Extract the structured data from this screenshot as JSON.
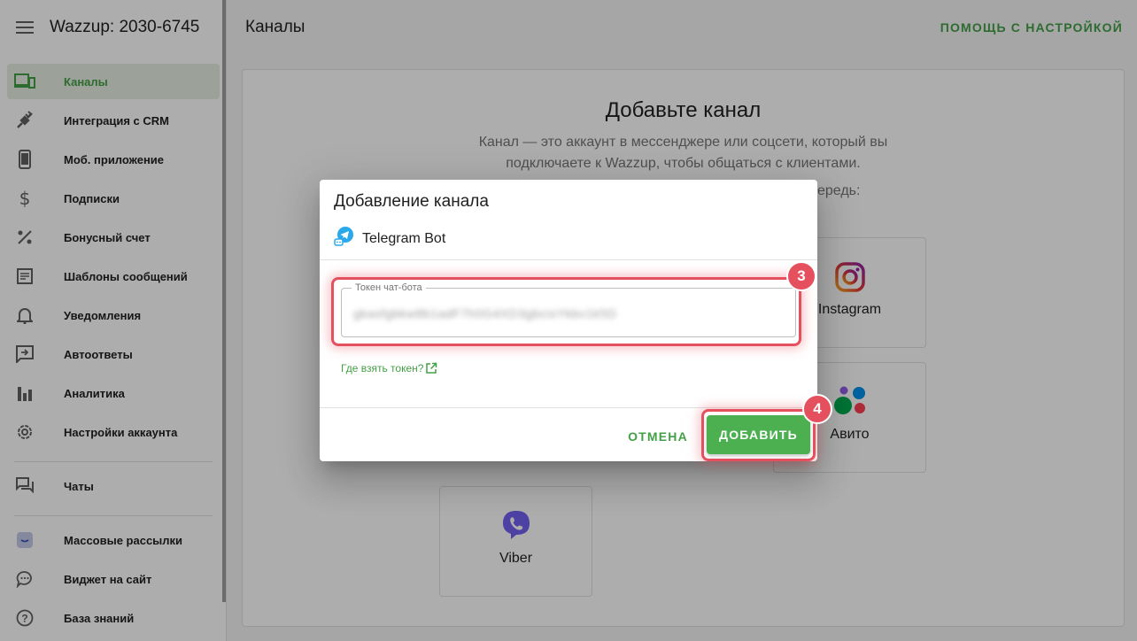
{
  "app": {
    "account_title": "Wazzup: 2030-6745"
  },
  "sidebar": {
    "items": [
      {
        "label": "Каналы",
        "icon": "devices-icon",
        "active": true
      },
      {
        "label": "Интеграция с CRM",
        "icon": "plug-icon"
      },
      {
        "label": "Моб. приложение",
        "icon": "smartphone-icon"
      },
      {
        "label": "Подписки",
        "icon": "dollar-icon"
      },
      {
        "label": "Бонусный счет",
        "icon": "percent-icon"
      },
      {
        "label": "Шаблоны сообщений",
        "icon": "document-icon"
      },
      {
        "label": "Уведомления",
        "icon": "bell-icon"
      },
      {
        "label": "Автоответы",
        "icon": "auto-reply-icon"
      },
      {
        "label": "Аналитика",
        "icon": "bar-chart-icon"
      },
      {
        "label": "Настройки аккаунта",
        "icon": "gear-icon"
      },
      {
        "label": "Чаты",
        "icon": "chats-icon"
      },
      {
        "label": "Массовые рассылки",
        "icon": "mailing-icon"
      },
      {
        "label": "Виджет на сайт",
        "icon": "chat-bubble-icon"
      },
      {
        "label": "База знаний",
        "icon": "help-icon"
      }
    ]
  },
  "header": {
    "page_title": "Каналы",
    "help_link": "ПОМОЩЬ С НАСТРОЙКОЙ"
  },
  "main": {
    "title": "Добавьте канал",
    "description_line1": "Канал — это аккаунт в мессенджере или соцсети, который вы",
    "description_line2": "подключаете к Wazzup, чтобы общаться с клиентами.",
    "hint_fragment": "ередь:",
    "channels": [
      {
        "label": "Instagram",
        "icon": "instagram-icon"
      },
      {
        "label": "Авито",
        "icon": "avito-icon"
      },
      {
        "label": "Viber",
        "icon": "viber-icon"
      }
    ]
  },
  "modal": {
    "title": "Добавление канала",
    "channel_name": "Telegram Bot",
    "token_label": "Токен чат-бота",
    "token_value": "gkasfgbkw8b1adF7h0G4XD3gbcisYkbv1k5D",
    "token_help_link": "Где взять токен?",
    "cancel_label": "ОТМЕНА",
    "add_label": "ДОБАВИТЬ"
  },
  "annotations": {
    "step_token": "3",
    "step_add": "4"
  },
  "colors": {
    "accent": "#43a047",
    "button": "#4caf50",
    "highlight": "#e5505e",
    "active_bg": "#e6efe3"
  }
}
